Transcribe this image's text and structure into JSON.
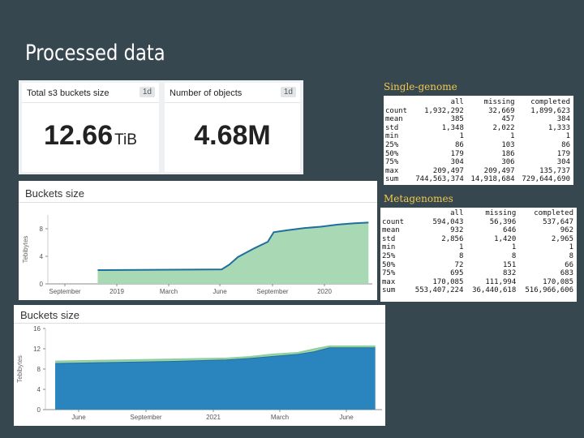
{
  "slide": {
    "title": "Processed data"
  },
  "metrics": [
    {
      "title": "Total s3 buckets size",
      "badge": "1d",
      "value": "12.66",
      "unit": "TiB"
    },
    {
      "title": "Number of objects",
      "badge": "1d",
      "value": "4.68M",
      "unit": ""
    }
  ],
  "charts": [
    {
      "title": "Buckets size",
      "chart_data": {
        "type": "area",
        "title": "Buckets size",
        "ylabel": "Tebibytes",
        "ylim": [
          0,
          10
        ],
        "yticks": [
          "0",
          "4",
          "8"
        ],
        "xticks": [
          "September",
          "2019",
          "March",
          "June",
          "September",
          "2020"
        ],
        "x": [
          "2018-08-01",
          "2018-10-15",
          "2019-06-01",
          "2019-06-15",
          "2019-07-01",
          "2019-08-01",
          "2019-08-25",
          "2019-09-05",
          "2019-10-01",
          "2019-11-01",
          "2019-12-01",
          "2020-01-01",
          "2020-02-01",
          "2020-02-27"
        ],
        "series": [
          {
            "values": [
              null,
              2.0,
              2.1,
              2.8,
              3.9,
              5.2,
              6.1,
              7.5,
              7.8,
              8.1,
              8.3,
              8.6,
              8.8,
              8.9
            ],
            "color": "#a8d8b4"
          }
        ],
        "grid": false,
        "legend": "none"
      }
    },
    {
      "title": "Buckets size",
      "chart_data": {
        "type": "area",
        "title": "Buckets size",
        "ylabel": "Tebibytes",
        "ylim": [
          0,
          16
        ],
        "yticks": [
          "0",
          "4",
          "8",
          "12",
          "16"
        ],
        "xticks": [
          "June",
          "September",
          "2021",
          "March",
          "June"
        ],
        "x": [
          "2020-05-01",
          "2020-07-15",
          "2020-10-01",
          "2020-12-15",
          "2021-01-15",
          "2021-02-15",
          "2021-03-20",
          "2021-04-10",
          "2021-05-01",
          "2021-06-01",
          "2021-07-01"
        ],
        "series": [
          {
            "values": [
              9.1,
              9.3,
              9.5,
              9.8,
              10.1,
              10.5,
              10.9,
              11.4,
              12.2,
              12.2,
              12.2
            ],
            "color": "#2a85bf"
          },
          {
            "values": [
              9.5,
              9.7,
              9.9,
              10.1,
              10.4,
              10.9,
              11.2,
              11.9,
              12.5,
              12.5,
              12.5
            ],
            "color": "#a8d8b4"
          }
        ],
        "grid": false,
        "legend": "none"
      }
    }
  ],
  "tables": [
    {
      "heading": "Single-genome",
      "columns": [
        "",
        "all",
        "missing",
        "completed"
      ],
      "rows": [
        [
          "count",
          "1,932,292",
          "32,669",
          "1,899,623"
        ],
        [
          "mean",
          "385",
          "457",
          "384"
        ],
        [
          "std",
          "1,348",
          "2,022",
          "1,333"
        ],
        [
          "min",
          "1",
          "1",
          "1"
        ],
        [
          "25%",
          "86",
          "103",
          "86"
        ],
        [
          "50%",
          "179",
          "186",
          "179"
        ],
        [
          "75%",
          "304",
          "306",
          "304"
        ],
        [
          "max",
          "209,497",
          "209,497",
          "135,737"
        ],
        [
          "sum",
          "744,563,374",
          "14,918,684",
          "729,644,690"
        ]
      ]
    },
    {
      "heading": "Metagenomes",
      "columns": [
        "",
        "all",
        "missing",
        "completed"
      ],
      "rows": [
        [
          "count",
          "594,043",
          "56,396",
          "537,647"
        ],
        [
          "mean",
          "932",
          "646",
          "962"
        ],
        [
          "std",
          "2,856",
          "1,420",
          "2,965"
        ],
        [
          "min",
          "1",
          "1",
          "1"
        ],
        [
          "25%",
          "8",
          "8",
          "8"
        ],
        [
          "50%",
          "72",
          "151",
          "66"
        ],
        [
          "75%",
          "695",
          "832",
          "683"
        ],
        [
          "max",
          "170,085",
          "111,994",
          "170,085"
        ],
        [
          "sum",
          "553,407,224",
          "36,440,618",
          "516,966,606"
        ]
      ]
    }
  ]
}
